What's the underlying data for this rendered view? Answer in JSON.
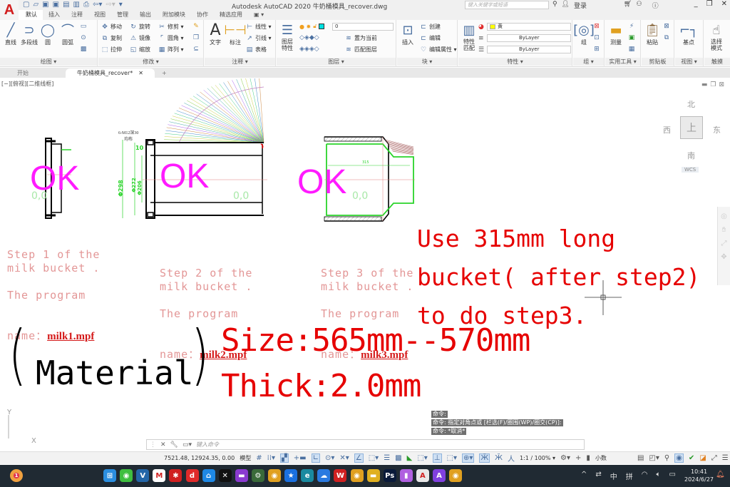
{
  "app": {
    "logo": "A",
    "title": "Autodesk AutoCAD 2020    牛奶桶模具_recover.dwg",
    "search_placeholder": "键入关键字或短语",
    "login": "登录",
    "quick_access": [
      "new-icon",
      "open-icon",
      "save-icon",
      "saveas-icon",
      "plot-icon",
      "publish-icon",
      "print-icon",
      "undo-icon",
      "redo-icon",
      "qat-menu-icon"
    ]
  },
  "menu_tabs": [
    "默认",
    "插入",
    "注释",
    "视图",
    "管理",
    "输出",
    "附加模块",
    "协作",
    "精选应用",
    "▣ ▾"
  ],
  "ribbon": {
    "draw": {
      "label": "绘图 ▾",
      "line": "直线",
      "polyline": "多段线",
      "circle": "圆",
      "arc": "圆弧"
    },
    "modify": {
      "label": "修改 ▾",
      "move": "移动",
      "rotate": "旋转",
      "trim": "修剪 ▾",
      "copy": "复制",
      "mirror": "镜像",
      "fillet": "圆角 ▾",
      "stretch": "拉伸",
      "scale": "缩放",
      "array": "阵列 ▾"
    },
    "annotation": {
      "label": "注释 ▾",
      "text": "文字",
      "dimension": "标注",
      "linear": "线性 ▾",
      "leader": "引线 ▾",
      "table": "表格"
    },
    "layers": {
      "label": "图层 ▾",
      "layer_props": "图层\n特性",
      "current_layer": "0",
      "make_current": "置为当前",
      "match_layer": "匹配图层"
    },
    "block": {
      "label": "块 ▾",
      "insert": "插入",
      "create": "创建",
      "edit": "编辑",
      "edit_attr": "编辑属性 ▾"
    },
    "properties": {
      "label": "特性 ▾",
      "match": "特性\n匹配",
      "color": "黄",
      "linetype": "ByLayer",
      "lineweight": "ByLayer",
      "color_hex": "#ffff00"
    },
    "groups": {
      "label": "组 ▾",
      "group": "组"
    },
    "utilities": {
      "label": "实用工具 ▾",
      "measure": "测量"
    },
    "clipboard": {
      "label": "剪贴板",
      "paste": "粘贴"
    },
    "view": {
      "label": "视图 ▾",
      "base": "基点"
    },
    "touch": {
      "label": "触摸",
      "select_mode": "选择\n模式"
    }
  },
  "doc_tabs": {
    "start": "开始",
    "active": "牛奶桶模具_recover*",
    "close": "✕",
    "add": "+"
  },
  "viewport": {
    "label": "[−][俯视][二维线框]",
    "viewcube": {
      "north": "北",
      "south": "南",
      "east": "东",
      "west": "西",
      "face": "上",
      "wcs": "WCS"
    }
  },
  "drawing": {
    "ok_marks": [
      "OK",
      "OK",
      "OK"
    ],
    "origin_labels": [
      "0,0",
      "0,0",
      "0,0"
    ],
    "step1": {
      "line1": "Step 1 of the",
      "line2": "milk bucket .",
      "line3": "The program",
      "line4": "name：",
      "program": "milk1.mpf"
    },
    "step2": {
      "line1": "Step 2 of the",
      "line2": "milk bucket .",
      "line3": "The program",
      "line4": "name：",
      "program": "milk2.mpf"
    },
    "step3": {
      "line1": "Step 3 of the",
      "line2": "milk bucket .",
      "line3": "The program",
      "line4": "name：",
      "program": "milk3.mpf"
    },
    "note": {
      "line1": "Use 315mm long",
      "line2": "bucket( after step2)",
      "line3": "to do step3."
    },
    "material": {
      "open": "(",
      "text": "Material",
      "close": ")"
    },
    "size": "Size:565mm--570mm",
    "thick": "Thick:2.0mm",
    "dims": {
      "hole": "6-M12深30",
      "distrib": "均布",
      "d298": "Φ298",
      "d272": "Φ272",
      "d206": "Φ206",
      "ten": "10",
      "len315": "315"
    },
    "ucs": {
      "x": "X",
      "y": "Y"
    }
  },
  "command": {
    "history": [
      "命令:",
      "命令: 指定对角点或 [栏选(F)/圈围(WP)/圈交(CP)]:",
      "命令: *取消*"
    ],
    "placeholder": "键入命令"
  },
  "status": {
    "coords": "7521.48, 12924.35, 0.00",
    "model": "模型",
    "scale": "1:1 / 100% ▾",
    "units": "小数"
  },
  "taskbar": {
    "apps": [
      "weather",
      "start",
      "wechat",
      "vmware",
      "m-app",
      "redstar",
      "dip",
      "home",
      "capcut",
      "clapper",
      "network-tool",
      "chrome",
      "star-app",
      "edge",
      "baidu-netdisk",
      "wps",
      "chrome-profile",
      "file-explorer",
      "photoshop",
      "notes",
      "autocad",
      "ai-app",
      "chrome-2"
    ],
    "weather_badge": "1",
    "tray": [
      "^",
      "⇄",
      "中",
      "拼",
      "wifi",
      "vol",
      "bat"
    ],
    "time": "10:41",
    "date": "2024/6/27"
  }
}
